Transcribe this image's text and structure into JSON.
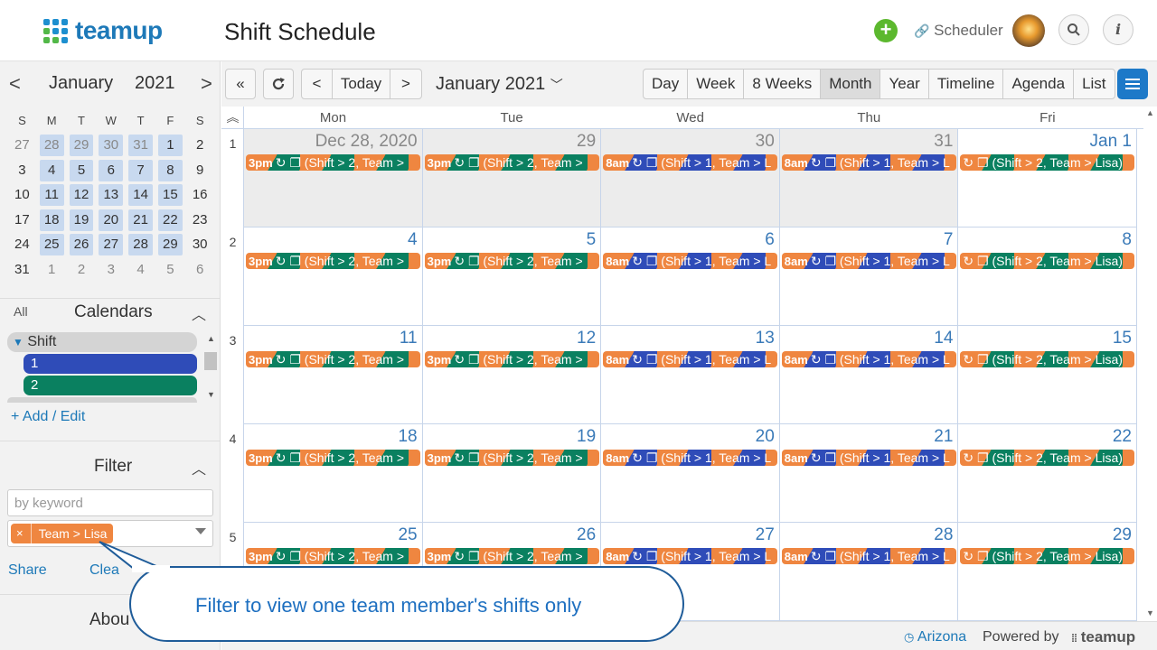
{
  "header": {
    "logo_text": "teamup",
    "title": "Shift Schedule",
    "add_symbol": "+",
    "scheduler_label": "Scheduler",
    "search_icon": "search-icon",
    "info_label": "i"
  },
  "sidebar": {
    "month": "January",
    "year": "2021",
    "prev": "<",
    "next": ">",
    "weekday_headers": [
      "S",
      "M",
      "T",
      "W",
      "T",
      "F",
      "S"
    ],
    "weeks": [
      [
        "27",
        "28",
        "29",
        "30",
        "31",
        "1",
        "2"
      ],
      [
        "3",
        "4",
        "5",
        "6",
        "7",
        "8",
        "9"
      ],
      [
        "10",
        "11",
        "12",
        "13",
        "14",
        "15",
        "16"
      ],
      [
        "17",
        "18",
        "19",
        "20",
        "21",
        "22",
        "23"
      ],
      [
        "24",
        "25",
        "26",
        "27",
        "28",
        "29",
        "30"
      ],
      [
        "31",
        "1",
        "2",
        "3",
        "4",
        "5",
        "6"
      ]
    ],
    "all_label": "All",
    "calendars_title": "Calendars",
    "calendar_folder": "Shift",
    "calendar_items": [
      {
        "label": "1",
        "color": "#2f4cb8"
      },
      {
        "label": "2",
        "color": "#0a8060"
      }
    ],
    "add_edit": "+ Add / Edit",
    "filter_title": "Filter",
    "keyword_placeholder": "by keyword",
    "filter_tag": "Team > Lisa",
    "filter_tag_remove": "×",
    "share": "Share",
    "clear": "Clea",
    "about": "Abou"
  },
  "toolbar": {
    "double_back": "«",
    "refresh": "⟳",
    "prev": "<",
    "today": "Today",
    "next": ">",
    "title": "January 2021",
    "views": [
      "Day",
      "Week",
      "8 Weeks",
      "Month",
      "Year",
      "Timeline",
      "Agenda",
      "List"
    ],
    "active_view": "Month"
  },
  "grid": {
    "weekdays": [
      "Mon",
      "Tue",
      "Wed",
      "Thu",
      "Fri"
    ],
    "collapse_icon": "double-chevron-up-icon",
    "weeks": [
      {
        "num": "1",
        "days": [
          {
            "label": "Dec 28, 2020",
            "past": true,
            "event": {
              "time": "3pm",
              "text": "↻ ❐ (Shift > 2, Team >",
              "c1": "#ef8640",
              "c2": "#0a8060"
            }
          },
          {
            "label": "29",
            "past": true,
            "event": {
              "time": "3pm",
              "text": "↻ ❐ (Shift > 2, Team >",
              "c1": "#ef8640",
              "c2": "#0a8060"
            }
          },
          {
            "label": "30",
            "past": true,
            "event": {
              "time": "8am",
              "text": "↻ ❐ (Shift > 1, Team > L",
              "c1": "#ef8640",
              "c2": "#2f4cb8"
            }
          },
          {
            "label": "31",
            "past": true,
            "event": {
              "time": "8am",
              "text": "↻ ❐ (Shift > 1, Team > L",
              "c1": "#ef8640",
              "c2": "#2f4cb8"
            }
          },
          {
            "label": "Jan 1",
            "past": false,
            "event": {
              "time": "",
              "text": "↻ ❐ (Shift > 2, Team > Lisa)",
              "c1": "#ef8640",
              "c2": "#0a8060"
            }
          }
        ]
      },
      {
        "num": "2",
        "days": [
          {
            "label": "4",
            "past": false,
            "event": {
              "time": "3pm",
              "text": "↻ ❐ (Shift > 2, Team >",
              "c1": "#ef8640",
              "c2": "#0a8060"
            }
          },
          {
            "label": "5",
            "past": false,
            "event": {
              "time": "3pm",
              "text": "↻ ❐ (Shift > 2, Team >",
              "c1": "#ef8640",
              "c2": "#0a8060"
            }
          },
          {
            "label": "6",
            "past": false,
            "event": {
              "time": "8am",
              "text": "↻ ❐ (Shift > 1, Team > L",
              "c1": "#ef8640",
              "c2": "#2f4cb8"
            }
          },
          {
            "label": "7",
            "past": false,
            "event": {
              "time": "8am",
              "text": "↻ ❐ (Shift > 1, Team > L",
              "c1": "#ef8640",
              "c2": "#2f4cb8"
            }
          },
          {
            "label": "8",
            "past": false,
            "event": {
              "time": "",
              "text": "↻ ❐ (Shift > 2, Team > Lisa)",
              "c1": "#ef8640",
              "c2": "#0a8060"
            }
          }
        ]
      },
      {
        "num": "3",
        "days": [
          {
            "label": "11",
            "past": false,
            "event": {
              "time": "3pm",
              "text": "↻ ❐ (Shift > 2, Team >",
              "c1": "#ef8640",
              "c2": "#0a8060"
            }
          },
          {
            "label": "12",
            "past": false,
            "event": {
              "time": "3pm",
              "text": "↻ ❐ (Shift > 2, Team >",
              "c1": "#ef8640",
              "c2": "#0a8060"
            }
          },
          {
            "label": "13",
            "past": false,
            "event": {
              "time": "8am",
              "text": "↻ ❐ (Shift > 1, Team > L",
              "c1": "#ef8640",
              "c2": "#2f4cb8"
            }
          },
          {
            "label": "14",
            "past": false,
            "event": {
              "time": "8am",
              "text": "↻ ❐ (Shift > 1, Team > L",
              "c1": "#ef8640",
              "c2": "#2f4cb8"
            }
          },
          {
            "label": "15",
            "past": false,
            "event": {
              "time": "",
              "text": "↻ ❐ (Shift > 2, Team > Lisa)",
              "c1": "#ef8640",
              "c2": "#0a8060"
            }
          }
        ]
      },
      {
        "num": "4",
        "days": [
          {
            "label": "18",
            "past": false,
            "event": {
              "time": "3pm",
              "text": "↻ ❐ (Shift > 2, Team >",
              "c1": "#ef8640",
              "c2": "#0a8060"
            }
          },
          {
            "label": "19",
            "past": false,
            "event": {
              "time": "3pm",
              "text": "↻ ❐ (Shift > 2, Team >",
              "c1": "#ef8640",
              "c2": "#0a8060"
            }
          },
          {
            "label": "20",
            "past": false,
            "event": {
              "time": "8am",
              "text": "↻ ❐ (Shift > 1, Team > L",
              "c1": "#ef8640",
              "c2": "#2f4cb8"
            }
          },
          {
            "label": "21",
            "past": false,
            "event": {
              "time": "8am",
              "text": "↻ ❐ (Shift > 1, Team > L",
              "c1": "#ef8640",
              "c2": "#2f4cb8"
            }
          },
          {
            "label": "22",
            "past": false,
            "event": {
              "time": "",
              "text": "↻ ❐ (Shift > 2, Team > Lisa)",
              "c1": "#ef8640",
              "c2": "#0a8060"
            }
          }
        ]
      },
      {
        "num": "5",
        "days": [
          {
            "label": "25",
            "past": false,
            "event": {
              "time": "3pm",
              "text": "↻ ❐ (Shift > 2, Team >",
              "c1": "#ef8640",
              "c2": "#0a8060"
            }
          },
          {
            "label": "26",
            "past": false,
            "event": {
              "time": "3pm",
              "text": "↻ ❐ (Shift > 2, Team >",
              "c1": "#ef8640",
              "c2": "#0a8060"
            }
          },
          {
            "label": "27",
            "past": false,
            "event": {
              "time": "8am",
              "text": "↻ ❐ (Shift > 1, Team > L",
              "c1": "#ef8640",
              "c2": "#2f4cb8"
            }
          },
          {
            "label": "28",
            "past": false,
            "event": {
              "time": "8am",
              "text": "↻ ❐ (Shift > 1, Team > L",
              "c1": "#ef8640",
              "c2": "#2f4cb8"
            }
          },
          {
            "label": "29",
            "past": false,
            "event": {
              "time": "",
              "text": "↻ ❐ (Shift > 2, Team > Lisa)",
              "c1": "#ef8640",
              "c2": "#0a8060"
            }
          }
        ]
      }
    ]
  },
  "footer": {
    "timezone": "Arizona",
    "powered_by": "Powered by",
    "powered_logo": "teamup"
  },
  "callout": {
    "text": "Filter to view one team member's shifts only"
  }
}
